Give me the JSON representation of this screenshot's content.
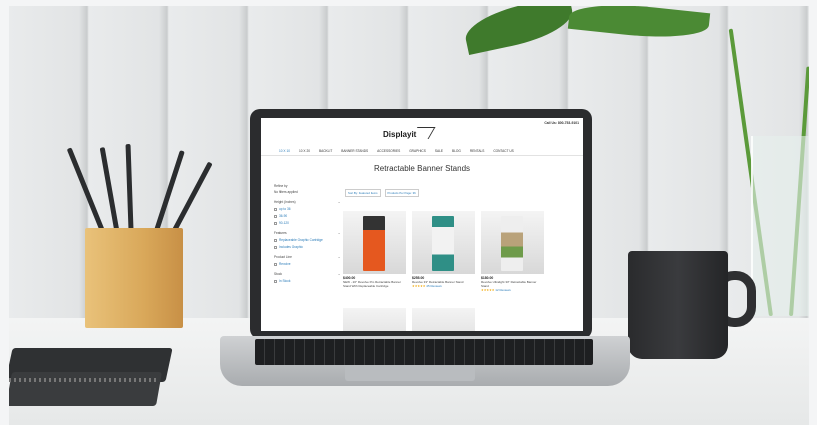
{
  "screen": {
    "call": "Call Us: 800-753-9101",
    "logo": "Displayit",
    "nav": [
      "10 X 10",
      "10 X 20",
      "BACKLIT",
      "BANNER STANDS",
      "ACCESSORIES",
      "GRAPHICS",
      "SALE",
      "BLOG",
      "RENTALS",
      "CONTACT US"
    ],
    "title": "Retractable Banner Stands",
    "sidebar": {
      "refine_label": "Refine by",
      "refine_value": "No filters applied",
      "groups": [
        {
          "label": "Height (Inches)",
          "options": [
            "up to 36",
            "36-90",
            "90-120"
          ]
        },
        {
          "label": "Features",
          "options": [
            "Replaceable Graphic Cartridge",
            "Includes Graphic"
          ]
        },
        {
          "label": "Product Line",
          "options": [
            "Revolve"
          ]
        },
        {
          "label": "Stock",
          "options": [
            "In Stock"
          ]
        }
      ]
    },
    "sort": [
      "Sort By: Featured Items",
      "Products Per Page: 36"
    ],
    "products": [
      {
        "price": "$400.00",
        "name": "NEW - 20\" Revolve Pro Retractable Banner Stand With Replaceable Cartridge",
        "stars": "★★★★★",
        "reviews": "",
        "color": "#e5581f"
      },
      {
        "price": "$255.00",
        "name": "Revolve 33\" Retractable Banner Stand",
        "stars": "★★★★★",
        "reviews": "45 Reviews",
        "color": "#2f8f86"
      },
      {
        "price": "$180.00",
        "name": "Revolve Ultralight 33\" Retractable Banner Stand",
        "stars": "★★★★★",
        "reviews": "12 Reviews",
        "color": "#b9a27a"
      }
    ]
  }
}
